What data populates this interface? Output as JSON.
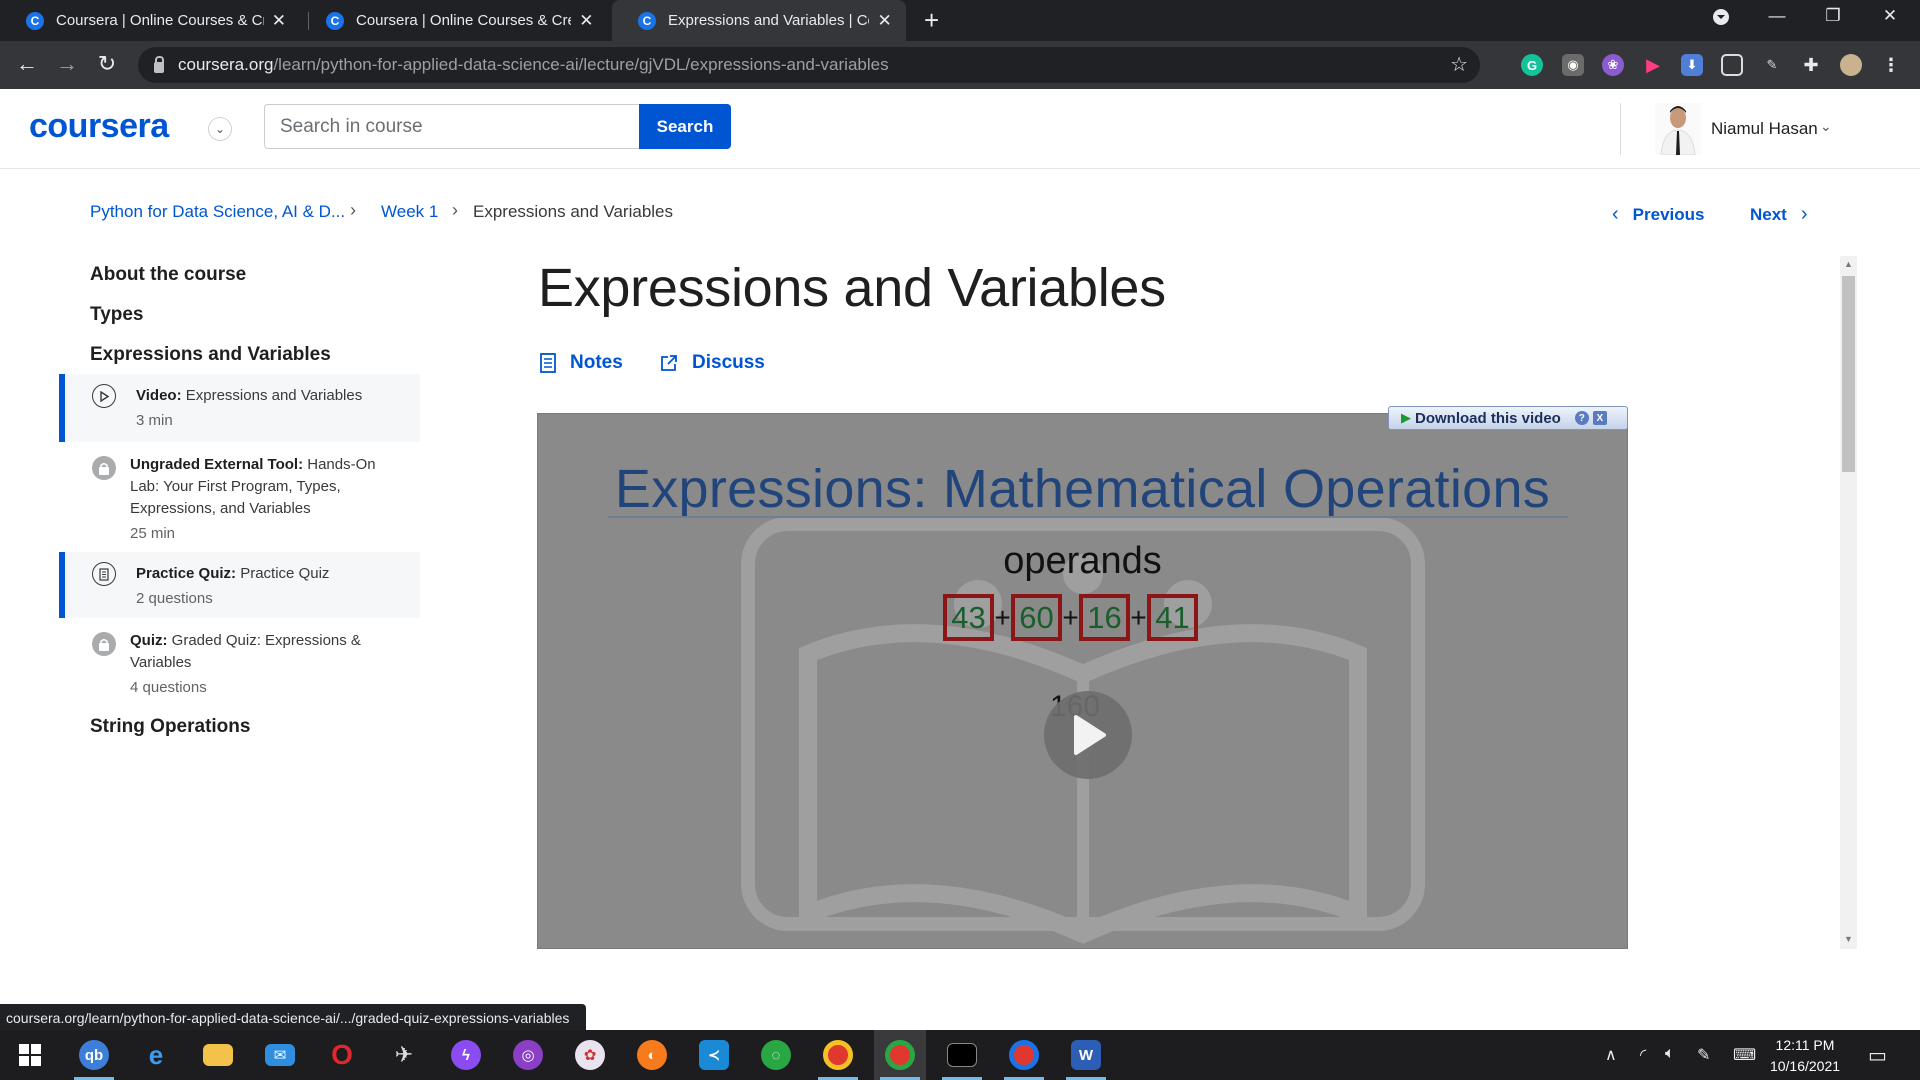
{
  "browser": {
    "tabs": [
      {
        "title": "Coursera | Online Courses & Credentials",
        "favicon": "C",
        "active": false
      },
      {
        "title": "Coursera | Online Courses & Credentials",
        "favicon": "C",
        "active": false
      },
      {
        "title": "Expressions and Variables | Coursera",
        "favicon": "C",
        "active": true
      }
    ],
    "address": {
      "host": "coursera.org",
      "path": "/learn/python-for-applied-data-science-ai/lecture/gjVDL/expressions-and-variables"
    },
    "status_url": "coursera.org/learn/python-for-applied-data-science-ai/.../graded-quiz-expressions-variables"
  },
  "header": {
    "logo": "coursera",
    "search_placeholder": "Search in course",
    "search_button": "Search",
    "user_name": "Niamul Hasan"
  },
  "breadcrumb": {
    "course": "Python for Data Science, AI & D...",
    "week": "Week 1",
    "current": "Expressions and Variables"
  },
  "pager": {
    "previous": "Previous",
    "next": "Next"
  },
  "sidebar": {
    "sections": [
      "About the course",
      "Types",
      "Expressions and Variables",
      "String Operations"
    ],
    "items": [
      {
        "kind": "Video:",
        "title": "Expressions and Variables",
        "meta": "3 min",
        "icon": "play-circle-icon",
        "active": true
      },
      {
        "kind": "Ungraded External Tool:",
        "title": "Hands-On Lab: Your First Program, Types, Expressions, and Variables",
        "meta": "25 min",
        "icon": "lock-icon",
        "active": false
      },
      {
        "kind": "Practice Quiz:",
        "title": "Practice Quiz",
        "meta": "2 questions",
        "icon": "quiz-icon",
        "active": true
      },
      {
        "kind": "Quiz:",
        "title": "Graded Quiz: Expressions & Variables",
        "meta": "4 questions",
        "icon": "lock-icon",
        "active": false
      }
    ]
  },
  "main": {
    "title": "Expressions and Variables",
    "notes_label": "Notes",
    "discuss_label": "Discuss"
  },
  "video": {
    "slide_title": "Expressions: Mathematical Operations",
    "slide_subtitle": "operands",
    "operands": [
      "43",
      "60",
      "16",
      "41"
    ],
    "operator": "+",
    "result": "160",
    "download_label": "Download this video",
    "help_label": "?",
    "close_label": "X"
  },
  "taskbar": {
    "apps": [
      "windows-start",
      "qbittorrent",
      "edge",
      "file-explorer",
      "mail",
      "opera",
      "satellite",
      "messenger",
      "github-desktop",
      "paint",
      "firefox",
      "vscode",
      "globe",
      "chrome",
      "chrome-active",
      "terminal",
      "chrome-profile",
      "word"
    ],
    "time": "12:11 PM",
    "date": "10/16/2021"
  },
  "colors": {
    "accent": "#0056d2",
    "chrome_dark": "#202124",
    "toolbar": "#35363a"
  }
}
